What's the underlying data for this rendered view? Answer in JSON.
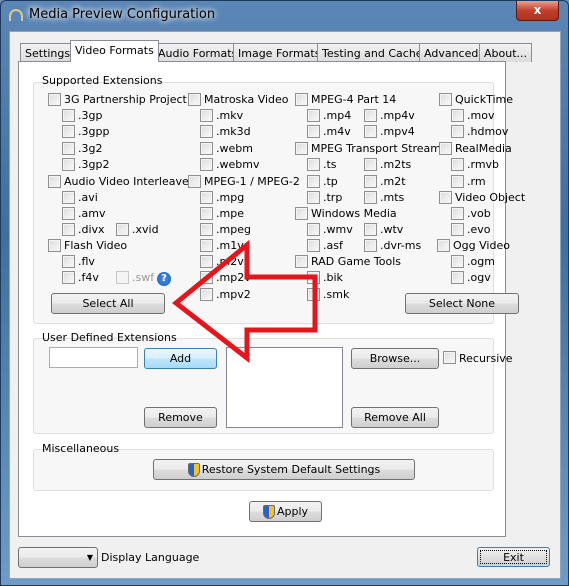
{
  "window": {
    "title": "Media Preview Configuration",
    "close": "x"
  },
  "tabs": [
    {
      "label": "Settings"
    },
    {
      "label": "Video Formats",
      "selected": true
    },
    {
      "label": "Audio Formats"
    },
    {
      "label": "Image Formats"
    },
    {
      "label": "Testing and Cache"
    },
    {
      "label": "Advanced"
    },
    {
      "label": "About..."
    }
  ],
  "supported": {
    "title": "Supported Extensions",
    "items": [
      {
        "label": "3G Partnership Project",
        "checked": false
      },
      {
        "label": ".3gp",
        "checked": false
      },
      {
        "label": ".3gpp",
        "checked": false
      },
      {
        "label": ".3g2",
        "checked": false
      },
      {
        "label": ".3gp2",
        "checked": false
      },
      {
        "label": "Audio Video Interleaved",
        "checked": false
      },
      {
        "label": ".avi",
        "checked": false
      },
      {
        "label": ".amv",
        "checked": false
      },
      {
        "label": ".divx",
        "checked": false
      },
      {
        "label": ".xvid",
        "checked": false
      },
      {
        "label": "Flash Video",
        "checked": false
      },
      {
        "label": ".flv",
        "checked": false
      },
      {
        "label": ".f4v",
        "checked": false
      },
      {
        "label": ".swf",
        "checked": false,
        "disabled": true
      },
      {
        "label": "Matroska Video",
        "checked": false
      },
      {
        "label": ".mkv",
        "checked": false
      },
      {
        "label": ".mk3d",
        "checked": false
      },
      {
        "label": ".webm",
        "checked": false
      },
      {
        "label": ".webmv",
        "checked": false
      },
      {
        "label": "MPEG-1 / MPEG-2",
        "checked": false
      },
      {
        "label": ".mpg",
        "checked": false
      },
      {
        "label": ".mpe",
        "checked": false
      },
      {
        "label": ".mpeg",
        "checked": false
      },
      {
        "label": ".m1v",
        "checked": false
      },
      {
        "label": ".m2v",
        "checked": false
      },
      {
        "label": ".mp2v",
        "checked": false
      },
      {
        "label": ".mpv2",
        "checked": false
      },
      {
        "label": "MPEG-4 Part 14",
        "checked": false
      },
      {
        "label": ".mp4",
        "checked": false
      },
      {
        "label": ".mp4v",
        "checked": false
      },
      {
        "label": ".m4v",
        "checked": false
      },
      {
        "label": ".mpv4",
        "checked": false
      },
      {
        "label": "MPEG Transport Stream",
        "checked": false
      },
      {
        "label": ".ts",
        "checked": false
      },
      {
        "label": ".m2ts",
        "checked": false
      },
      {
        "label": ".tp",
        "checked": false
      },
      {
        "label": ".m2t",
        "checked": false
      },
      {
        "label": ".trp",
        "checked": false
      },
      {
        "label": ".mts",
        "checked": false
      },
      {
        "label": "Windows Media",
        "checked": false
      },
      {
        "label": ".wmv",
        "checked": false
      },
      {
        "label": ".wtv",
        "checked": false
      },
      {
        "label": ".asf",
        "checked": false
      },
      {
        "label": ".dvr-ms",
        "checked": false
      },
      {
        "label": "RAD Game Tools",
        "checked": false
      },
      {
        "label": ".bik",
        "checked": false
      },
      {
        "label": ".smk",
        "checked": false
      },
      {
        "label": "QuickTime",
        "checked": false
      },
      {
        "label": ".mov",
        "checked": false
      },
      {
        "label": ".hdmov",
        "checked": false
      },
      {
        "label": "RealMedia",
        "checked": false
      },
      {
        "label": ".rmvb",
        "checked": false
      },
      {
        "label": ".rm",
        "checked": false
      },
      {
        "label": "Video Object",
        "checked": false
      },
      {
        "label": ".vob",
        "checked": false
      },
      {
        "label": ".evo",
        "checked": false
      },
      {
        "label": "Ogg Video",
        "checked": false
      },
      {
        "label": ".ogm",
        "checked": false
      },
      {
        "label": ".ogv",
        "checked": false
      }
    ],
    "select_all": "Select All",
    "select_none": "Select None",
    "help_icon": "?"
  },
  "user_defined": {
    "title": "User Defined Extensions",
    "input_value": "",
    "add": "Add",
    "remove": "Remove",
    "browse": "Browse...",
    "remove_all": "Remove All",
    "recursive": "Recursive",
    "recursive_checked": false
  },
  "misc": {
    "title": "Miscellaneous",
    "restore": "Restore System Default Settings"
  },
  "apply": "Apply",
  "language": {
    "selected": "",
    "label": "Display Language"
  },
  "exit": "Exit",
  "annotation": {
    "color": "#e8141c",
    "shape": "arrow-left"
  }
}
